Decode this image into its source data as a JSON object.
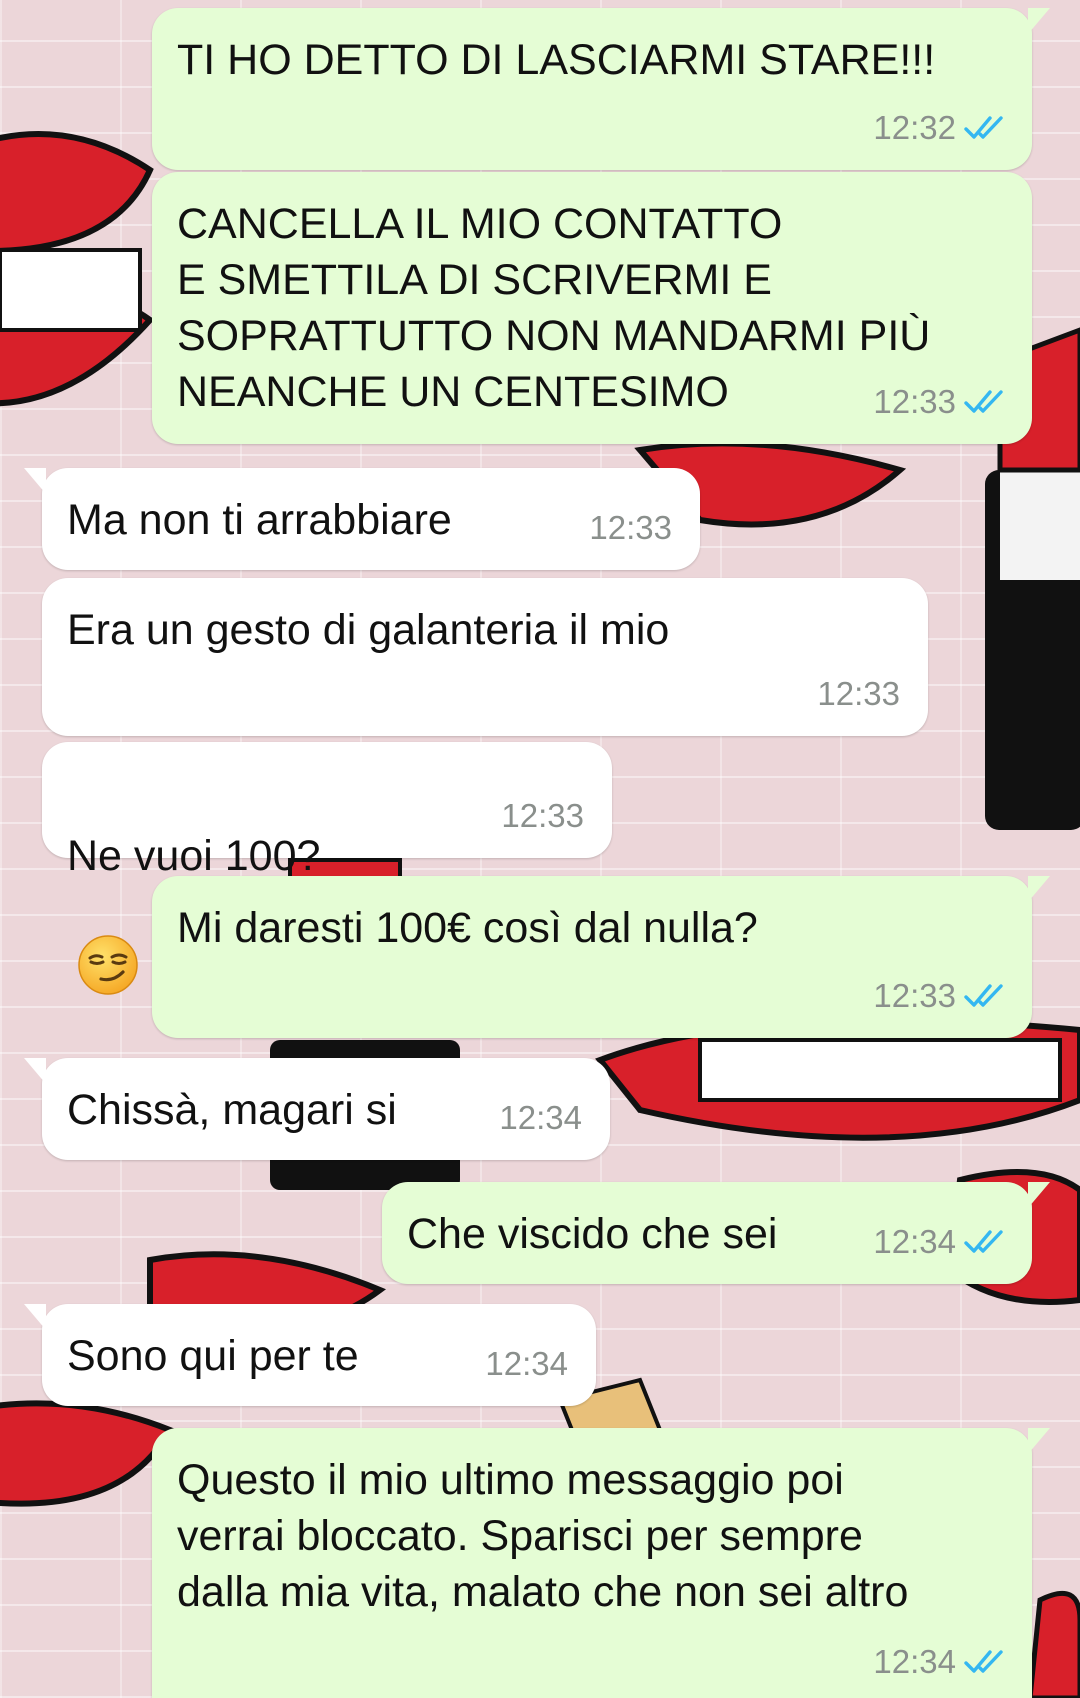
{
  "chat": {
    "messages": [
      {
        "side": "out",
        "text": "TI HO DETTO DI LASCIARMI STARE!!!",
        "time": "12:32",
        "ticks": "double-check-read-icon"
      },
      {
        "side": "out",
        "text": "CANCELLA IL MIO CONTATTO\nE SMETTILA DI SCRIVERMI E\nSOPRATTUTTO NON MANDARMI PIÙ\nNEANCHE UN CENTESIMO",
        "time": "12:33",
        "ticks": "double-check-read-icon"
      },
      {
        "side": "in",
        "text": "Ma non ti arrabbiare",
        "time": "12:33"
      },
      {
        "side": "in",
        "text": "Era un gesto di galanteria il mio",
        "time": "12:33"
      },
      {
        "side": "in",
        "text": "Ne vuoi 100?",
        "emoji": "smirking-face-icon",
        "time": "12:33"
      },
      {
        "side": "out",
        "text": "Mi daresti 100€ così dal nulla?",
        "time": "12:33",
        "ticks": "double-check-read-icon"
      },
      {
        "side": "in",
        "text": "Chissà, magari si",
        "time": "12:34"
      },
      {
        "side": "out",
        "text": "Che viscido che sei",
        "time": "12:34",
        "ticks": "double-check-read-icon"
      },
      {
        "side": "in",
        "text": "Sono qui per te",
        "time": "12:34"
      },
      {
        "side": "out",
        "text": "Questo il mio ultimo messaggio poi\nverrai bloccato. Sparisci per sempre\ndalla mia vita, malato che non sei altro",
        "time": "12:34",
        "ticks": "double-check-read-icon"
      }
    ]
  },
  "colors": {
    "outgoing_bubble": "#e5fdd5",
    "incoming_bubble": "#ffffff",
    "read_ticks": "#34b7f1",
    "timestamp": "#8a8f8c",
    "wallpaper": "#ecd6d9",
    "wallpaper_lips": "#d8202a"
  }
}
